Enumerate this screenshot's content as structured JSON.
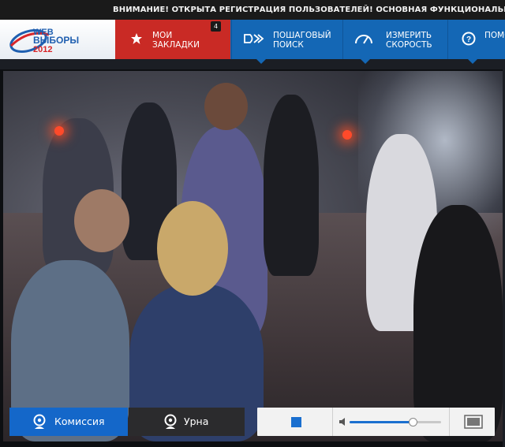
{
  "announcement": "ВНИМАНИЕ! ОТКРЫТА РЕГИСТРАЦИЯ ПОЛЬЗОВАТЕЛЕЙ! ОСНОВНАЯ ФУНКЦИОНАЛЬНОСТЬ САЙТА Е",
  "logo": {
    "line1": "WEB",
    "line2": "ВЫБОРЫ",
    "line3": "2012"
  },
  "nav": {
    "bookmarks": {
      "line1": "МОИ",
      "line2": "ЗАКЛАДКИ",
      "badge": "4",
      "icon": "star-icon"
    },
    "step_search": {
      "line1": "ПОШАГОВЫЙ",
      "line2": "ПОИСК",
      "icon": "double-arrow-icon"
    },
    "speed": {
      "line1": "ИЗМЕРИТЬ",
      "line2": "СКОРОСТЬ",
      "icon": "speedometer-icon"
    },
    "help": {
      "line1": "ПОМО",
      "icon": "question-icon"
    }
  },
  "cameras": {
    "commission": "Комиссия",
    "urn": "Урна",
    "icon": "webcam-icon"
  },
  "player": {
    "volume": 0.68,
    "controls": [
      "stop-icon",
      "volume-icon",
      "fullscreen-icon"
    ]
  },
  "colors": {
    "announcement_bg": "#1a1a1a",
    "nav_bg": "#1467b5",
    "bookmarks_bg": "#c92a25",
    "camera_active": "#1467c9",
    "camera_inactive": "#2b2b2d",
    "player_bg": "#f2f2f2"
  }
}
